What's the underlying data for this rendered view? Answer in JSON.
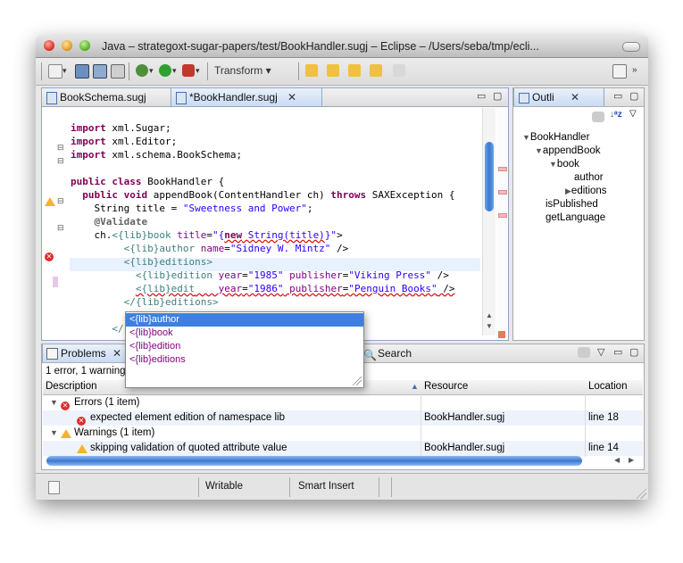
{
  "window": {
    "title": "Java – strategoxt-sugar-papers/test/BookHandler.sugj – Eclipse – /Users/seba/tmp/ecli..."
  },
  "toolbar": {
    "transform_label": "Transform ▾"
  },
  "editor": {
    "tabs": [
      {
        "label": "BookSchema.sugj"
      },
      {
        "label": "*BookHandler.sugj"
      }
    ],
    "code_lines": [
      "import xml.Sugar;",
      "import xml.Editor;",
      "import xml.schema.BookSchema;",
      "",
      "public class BookHandler {",
      "  public void appendBook(ContentHandler ch) throws SAXException {",
      "    String title = \"Sweetness and Power\";",
      "    @Validate",
      "    ch.<{lib}book title=\"{new String(title)}\">",
      "         <{lib}author name=\"Sidney W. Mintz\" />",
      "         <{lib}editions>",
      "           <{lib}edition year=\"1985\" publisher=\"Viking Press\" />",
      "           <{lib}edit    year=\"1986\" publisher=\"Penguin Books\" />",
      "         </{lib}editions>",
      "",
      "       </"
    ]
  },
  "autocomplete": {
    "items": [
      "<{lib}author",
      "<{lib}book",
      "<{lib}edition",
      "<{lib}editions"
    ],
    "selected_index": 0
  },
  "outline": {
    "tab_label": "Outli",
    "tree": [
      {
        "label": "BookHandler",
        "depth": 0,
        "expander": "open"
      },
      {
        "label": "appendBook",
        "depth": 1,
        "expander": "open"
      },
      {
        "label": "book",
        "depth": 2,
        "expander": "open"
      },
      {
        "label": "author",
        "depth": 3,
        "expander": "none"
      },
      {
        "label": "editions",
        "depth": 3,
        "expander": "closed"
      },
      {
        "label": "isPublished",
        "depth": 1,
        "expander": "none"
      },
      {
        "label": "getLanguage",
        "depth": 1,
        "expander": "none"
      }
    ]
  },
  "problems": {
    "tab_label": "Problems",
    "search_tab_label": "Search",
    "summary": "1 error, 1 warning",
    "columns": [
      "Description",
      "Resource",
      "Location"
    ],
    "groups": [
      {
        "label": "Errors (1 item)",
        "type": "error",
        "items": [
          {
            "description": "expected element edition of namespace lib",
            "resource": "BookHandler.sugj",
            "location": "line 18"
          }
        ]
      },
      {
        "label": "Warnings (1 item)",
        "type": "warning",
        "items": [
          {
            "description": "skipping validation of quoted attribute value",
            "resource": "BookHandler.sugj",
            "location": "line 14"
          }
        ]
      }
    ]
  },
  "status": {
    "writable": "Writable",
    "insert_mode": "Smart Insert"
  },
  "colors": {
    "selection": "#3d80df",
    "keyword": "#7f0055",
    "string": "#2a00ff",
    "error": "#d9302a",
    "warning": "#f1b42f"
  }
}
